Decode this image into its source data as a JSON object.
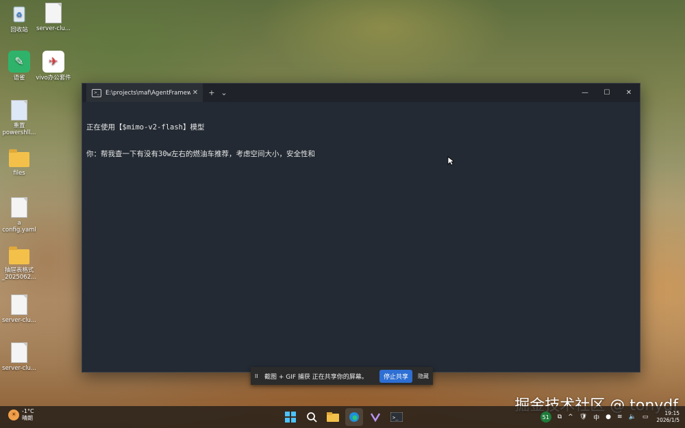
{
  "desktop": {
    "icons": [
      {
        "label": "回收站",
        "icon": "recycle-bin-icon"
      },
      {
        "label": "server-clu...",
        "icon": "file-icon"
      },
      {
        "label": "语雀",
        "icon": "yuque-icon"
      },
      {
        "label": "vivo办公套件",
        "icon": "vivo-office-icon"
      },
      {
        "label": "重置\npowershll...",
        "icon": "powershell-icon"
      },
      {
        "label": "files",
        "icon": "folder-icon"
      },
      {
        "label": "a\nconfig.yaml",
        "icon": "file-icon"
      },
      {
        "label": "抽屉表格式\n_2025062...",
        "icon": "folder-icon"
      },
      {
        "label": "server-clu...",
        "icon": "file-icon"
      },
      {
        "label": "server-clu...",
        "icon": "file-icon"
      }
    ]
  },
  "terminal": {
    "tab_title": "E:\\projects\\maf\\AgentFramew",
    "tab_close": "✕",
    "new_tab": "+",
    "dropdown": "⌄",
    "minimize": "—",
    "maximize": "☐",
    "close": "✕",
    "lines": [
      "正在使用【$mimo-v2-flash】模型",
      "你：帮我查一下有没有30w左右的燃油车推荐，考虑空间大小，安全性和"
    ]
  },
  "sharebar": {
    "pause": "II",
    "text": "截图 + GIF 捕获 正在共享你的屏幕。",
    "stop_label": "停止共享",
    "hide_label": "隐藏"
  },
  "watermark": "掘金技术社区 @ tonydf",
  "taskbar": {
    "weather_temp": "-1°C",
    "weather_desc": "晴朗",
    "apps": [
      "windows-start-icon",
      "search-icon",
      "file-explorer-icon",
      "edge-icon",
      "visual-studio-icon",
      "terminal-icon"
    ],
    "tray_badge": "51",
    "tray_ime": "中",
    "time": "19:15",
    "date": "2026/1/5"
  },
  "colors": {
    "terminal_bg": "#232a33",
    "titlebar_bg": "#1f2228",
    "share_button": "#2d6fd3"
  }
}
